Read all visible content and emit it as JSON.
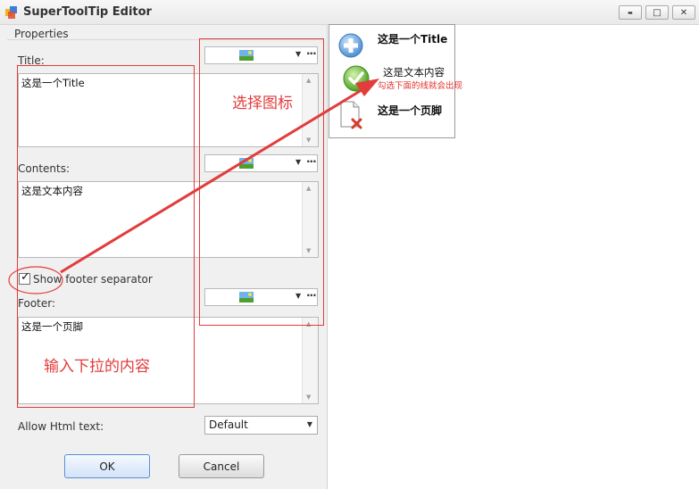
{
  "window": {
    "title": "SuperToolTip Editor"
  },
  "window_controls": {
    "minimize": "▬",
    "maximize": "□",
    "close": "✕"
  },
  "properties": {
    "group_label": "Properties",
    "title_label": "Title:",
    "title_value": "这是一个Title",
    "contents_label": "Contents:",
    "contents_value": "这是文本内容",
    "show_footer_separator": {
      "label": "Show footer separator",
      "checked": true
    },
    "footer_label": "Footer:",
    "footer_value": "这是一个页脚",
    "allow_html_label": "Allow Html text:",
    "allow_html_value": "Default"
  },
  "image_combo": {
    "arrow": "▼",
    "more": "···"
  },
  "buttons": {
    "ok": "OK",
    "cancel": "Cancel"
  },
  "preview": {
    "title": "这是一个Title",
    "content": "这是文本内容",
    "footer": "这是一个页脚",
    "note": "勾选下面的线就会出现"
  },
  "annotations": {
    "select_icon": "选择图标",
    "enter_dropdown": "输入下拉的内容"
  },
  "colors": {
    "annotation": "#e23c3c",
    "accent": "#5a8fd6"
  },
  "icons": [
    "app-icon",
    "image-icon",
    "plus-icon",
    "check-icon",
    "page-x-icon"
  ]
}
